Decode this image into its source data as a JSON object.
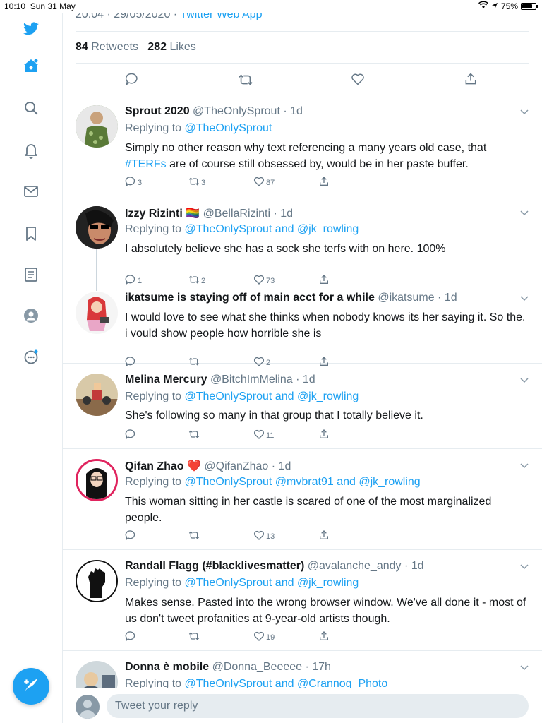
{
  "status": {
    "time": "10:10",
    "date": "Sun 31 May",
    "battery": "75%",
    "battery_level": 0.75
  },
  "main_tweet": {
    "timestamp": "20:04 · 29/05/2020 · ",
    "source": "Twitter Web App",
    "retweets": "84",
    "retweets_label": "Retweets",
    "likes": "282",
    "likes_label": "Likes"
  },
  "replies": [
    {
      "name": "Sprout 2020",
      "handle": "@TheOnlySprout · 1d",
      "replying_prefix": "Replying to ",
      "replying_to": "@TheOnlySprout",
      "text_before": "Simply no other reason why text referencing a many years old case, that ",
      "hashtag": "#TERFs",
      "text_after": " are of course still obsessed by, would be in her paste buffer.",
      "replies": "3",
      "retweets": "3",
      "likes": "87"
    },
    {
      "name": "Izzy Rizinti 🏳️‍🌈",
      "handle": "@BellaRizinti · 1d",
      "replying_prefix": "Replying to ",
      "replying_to": "@TheOnlySprout and @jk_rowling",
      "text": "I absolutely believe she has a sock she terfs with on here. 100%",
      "replies": "1",
      "retweets": "2",
      "likes": "73"
    },
    {
      "name": "ikatsume is staying off of main acct for a while",
      "handle": "@ikatsume · 1d",
      "text": "I would love to see what she thinks when nobody knows its her saying it. So the. i vould show people how horrible she is",
      "replies": "",
      "retweets": "",
      "likes": "2"
    },
    {
      "name": "Melina Mercury",
      "handle": "@BitchImMelina · 1d",
      "replying_prefix": "Replying to ",
      "replying_to": "@TheOnlySprout and @jk_rowling",
      "text": "She's following so many in that group that I totally believe it.",
      "replies": "",
      "retweets": "",
      "likes": "11"
    },
    {
      "name": "Qifan Zhao ❤️",
      "handle": "@QifanZhao · 1d",
      "replying_prefix": "Replying to ",
      "replying_to": "@TheOnlySprout @mvbrat91 and @jk_rowling",
      "text": "This woman sitting in her castle is scared of one of the most marginalized people.",
      "replies": "",
      "retweets": "",
      "likes": "13"
    },
    {
      "name": "Randall Flagg (#blacklivesmatter)",
      "handle": "@avalanche_andy · 1d",
      "replying_prefix": "Replying to ",
      "replying_to": "@TheOnlySprout and @jk_rowling",
      "text": "Makes sense. Pasted into the wrong browser window. We've all done it - most of us don't tweet profanities at 9-year-old artists though.",
      "replies": "",
      "retweets": "",
      "likes": "19"
    },
    {
      "name": "Donna è mobile",
      "handle": "@Donna_Beeeee · 17h",
      "replying_prefix": "Replying to ",
      "replying_to": "@TheOnlySprout and @Crannog_Photo"
    }
  ],
  "reply_bar": {
    "placeholder": "Tweet your reply"
  },
  "colors": {
    "accent": "#1da1f2",
    "secondary_text": "#657786",
    "border": "#e6ecf0"
  },
  "icons": [
    "twitter-logo-icon",
    "home-icon",
    "search-icon",
    "bell-icon",
    "mail-icon",
    "bookmark-icon",
    "list-icon",
    "profile-icon",
    "more-icon",
    "compose-icon"
  ]
}
